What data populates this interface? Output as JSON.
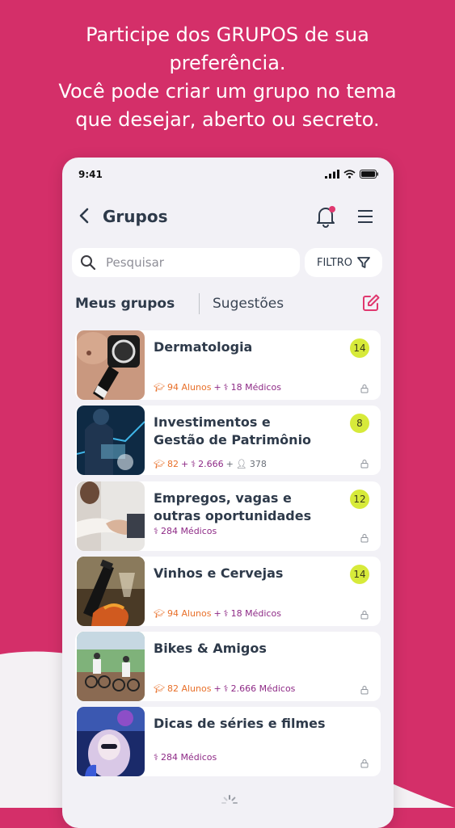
{
  "headline": {
    "line1": "Participe dos GRUPOS de sua",
    "line2": "preferência.",
    "line3": "Você pode criar um grupo no tema",
    "line4": "que desejar, aberto ou secreto."
  },
  "status_bar": {
    "time": "9:41"
  },
  "nav": {
    "title": "Grupos"
  },
  "search": {
    "placeholder": "Pesquisar"
  },
  "filter": {
    "label": "FILTRO"
  },
  "tabs": {
    "active": "Meus grupos",
    "inactive": "Sugestões"
  },
  "colors": {
    "background": "#d42f69",
    "accent": "#e0386f",
    "badge": "#d7ea3a",
    "alunos": "#e8702a",
    "medicos": "#8e2a86"
  },
  "groups": [
    {
      "title": "Dermatologia",
      "badge": "14",
      "alunos": "94 Alunos",
      "plus": "+",
      "medicos": "18 Médicos"
    },
    {
      "title": "Investimentos e",
      "title2": "Gestão de Patrimônio",
      "badge": "8",
      "a": "82",
      "plus1": "+",
      "m": "2.666",
      "plus2": "+",
      "o": "378"
    },
    {
      "title": "Empregos, vagas e",
      "title2": "outras oportunidades",
      "badge": "12",
      "medicos": "284 Médicos"
    },
    {
      "title": "Vinhos e Cervejas",
      "badge": "14",
      "alunos": "94 Alunos",
      "plus": "+",
      "medicos": "18 Médicos"
    },
    {
      "title": "Bikes & Amigos",
      "alunos": "82 Alunos",
      "plus": "+",
      "medicos": "2.666 Médicos"
    },
    {
      "title": "Dicas de séries e filmes",
      "medicos": "284 Médicos"
    }
  ]
}
